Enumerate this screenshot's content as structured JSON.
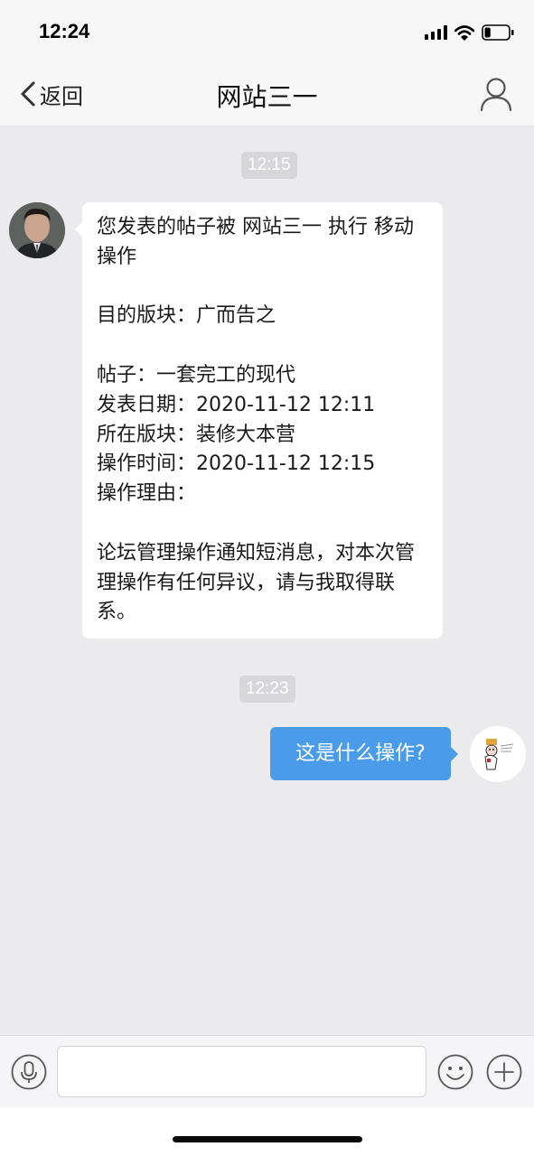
{
  "status_bar": {
    "time": "12:24",
    "icons": [
      "cellular-signal-icon",
      "wifi-icon",
      "battery-icon"
    ],
    "battery_level": 0.25
  },
  "nav": {
    "back_label": "返回",
    "title": "网站三一",
    "back_icon": "chevron-left-icon",
    "profile_icon": "person-icon"
  },
  "messages": [
    {
      "timestamp": "12:15",
      "direction": "incoming",
      "avatar": "avatar-man-in-suit",
      "text": "您发表的帖子被 网站三一 执行 移动 操作\n\n目的版块：广而告之\n\n帖子：一套完工的现代\n发表日期：2020-11-12 12:11\n所在版块：装修大本营\n操作时间：2020-11-12 12:15\n操作理由：\n\n论坛管理操作通知短消息，对本次管理操作有任何异议，请与我取得联系。"
    },
    {
      "timestamp": "12:23",
      "direction": "outgoing",
      "avatar": "avatar-cartoon-sticker",
      "text": "这是什么操作?"
    }
  ],
  "input_bar": {
    "value": "",
    "placeholder": "",
    "icons": [
      "microphone-icon",
      "emoji-icon",
      "plus-icon"
    ]
  },
  "colors": {
    "chat_background": "#EBEBEE",
    "outgoing_bubble": "#4A9CEB",
    "incoming_bubble": "#FFFFFF",
    "timestamp_badge": "#D7D7DA"
  }
}
